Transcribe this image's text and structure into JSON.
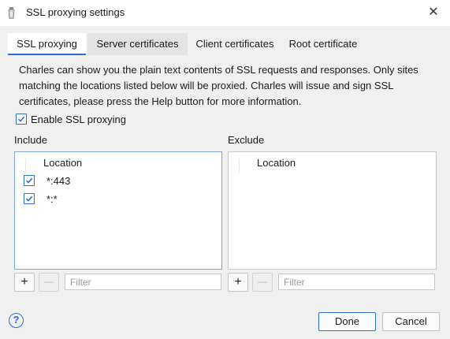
{
  "window": {
    "title": "SSL proxying settings",
    "app_icon": "charles-jar-icon",
    "close_icon": "close-icon",
    "close_glyph": "✕"
  },
  "tabs": [
    {
      "label": "SSL proxying",
      "active": true
    },
    {
      "label": "Server certificates",
      "active": false
    },
    {
      "label": "Client certificates",
      "active": false
    },
    {
      "label": "Root certificate",
      "active": false
    }
  ],
  "description": "Charles can show you the plain text contents of SSL requests and responses. Only sites matching the locations listed below will be proxied. Charles will issue and sign SSL certificates, please press the Help button for more information.",
  "enable_ssl": {
    "label": "Enable SSL proxying",
    "checked": true
  },
  "include": {
    "label": "Include",
    "column_header": "Location",
    "rows": [
      {
        "location": "*:443",
        "checked": true
      },
      {
        "location": "*:*",
        "checked": true
      }
    ],
    "add_glyph": "+",
    "remove_glyph": "—",
    "filter_placeholder": "Filter"
  },
  "exclude": {
    "label": "Exclude",
    "column_header": "Location",
    "rows": [],
    "add_glyph": "+",
    "remove_glyph": "—",
    "filter_placeholder": "Filter"
  },
  "footer": {
    "help_glyph": "?",
    "done_label": "Done",
    "cancel_label": "Cancel"
  },
  "colors": {
    "accent": "#2a6fd6",
    "background": "#f0f0f0"
  }
}
